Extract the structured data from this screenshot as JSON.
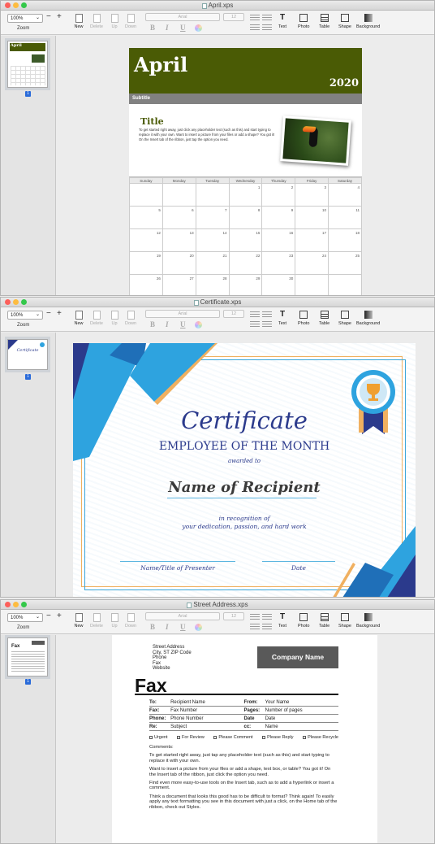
{
  "toolbar": {
    "zoom_value": "100%",
    "zoom_minus": "−",
    "zoom_plus": "+",
    "zoom_label": "Zoom",
    "new": "New",
    "delete": "Delete",
    "up": "Up",
    "down": "Down",
    "font": "Arial",
    "size": "12",
    "bold": "B",
    "italic": "I",
    "underline": "U",
    "text": "Text",
    "photo": "Photo",
    "table": "Table",
    "shape": "Shape",
    "background": "Background"
  },
  "windows": [
    {
      "title": "April.xps",
      "page_badge": "1"
    },
    {
      "title": "Certificate.xps",
      "page_badge": "1"
    },
    {
      "title": "Street Address.xps",
      "page_badge": "1"
    }
  ],
  "calendar": {
    "month": "April",
    "year": "2020",
    "subtitle": "Subtitle",
    "title": "Title",
    "body": "To get started right away, just click any placeholder text (such as this) and start typing to replace it with your own. Want to insert a picture from your files or add a shape? You got it! On the Insert tab of the ribbon, just tap the option you need.",
    "weekdays": [
      "Sunday",
      "Monday",
      "Tuesday",
      "Wednesday",
      "Thursday",
      "Friday",
      "Saturday"
    ],
    "weeks": [
      [
        "",
        "",
        "",
        "1",
        "2",
        "3",
        "4"
      ],
      [
        "5",
        "6",
        "7",
        "8",
        "9",
        "10",
        "11"
      ],
      [
        "12",
        "13",
        "14",
        "15",
        "16",
        "17",
        "18"
      ],
      [
        "19",
        "20",
        "21",
        "22",
        "23",
        "24",
        "25"
      ],
      [
        "26",
        "27",
        "28",
        "29",
        "30",
        "",
        ""
      ]
    ]
  },
  "certificate": {
    "title": "Certificate",
    "subtitle": "EMPLOYEE OF THE MONTH",
    "awarded": "awarded to",
    "recipient": "Name of Recipient",
    "recognition_1": "in recognition of",
    "recognition_2": "your dedication, passion, and hard work",
    "presenter": "Name/Title of Presenter",
    "date": "Date",
    "thumb_title": "Certificate"
  },
  "fax": {
    "address": [
      "Street Address",
      "City, ST ZIP Code",
      "Phone",
      "Fax",
      "Website"
    ],
    "company": "Company Name",
    "title": "Fax",
    "rows": [
      {
        "l1": "To:",
        "v1": "Recipient Name",
        "l2": "From:",
        "v2": "Your Name"
      },
      {
        "l1": "Fax:",
        "v1": "Fax Number",
        "l2": "Pages:",
        "v2": "Number of pages"
      },
      {
        "l1": "Phone:",
        "v1": "Phone Number",
        "l2": "Date",
        "v2": "Date"
      },
      {
        "l1": "Re:",
        "v1": "Subject",
        "l2": "cc:",
        "v2": "Name"
      }
    ],
    "checks": [
      "Urgent",
      "For Review",
      "Please Comment",
      "Please Reply",
      "Please Recycle"
    ],
    "comments_label": "Comments:",
    "paragraphs": [
      "To get started right away, just tap any placeholder text (such as this) and start typing to replace it with your own.",
      "Want to insert a picture from your files or add a shape, text box, or table? You got it! On the Insert tab of the ribbon, just click the option you need.",
      "Find even more easy-to-use tools on the Insert tab, such as to add a hyperlink or insert a comment.",
      "Think a document that looks this good has to be difficult to format? Think again! To easily apply any text formatting you see in this document with just a click, on the Home tab of the ribbon, check out Styles."
    ]
  },
  "colors": {
    "calendar_green": "#4a5b05",
    "cert_blue": "#2b3a8c",
    "cert_cyan": "#2ea3df",
    "fax_company_bg": "#595959",
    "badge_blue": "#2a6bd9"
  }
}
